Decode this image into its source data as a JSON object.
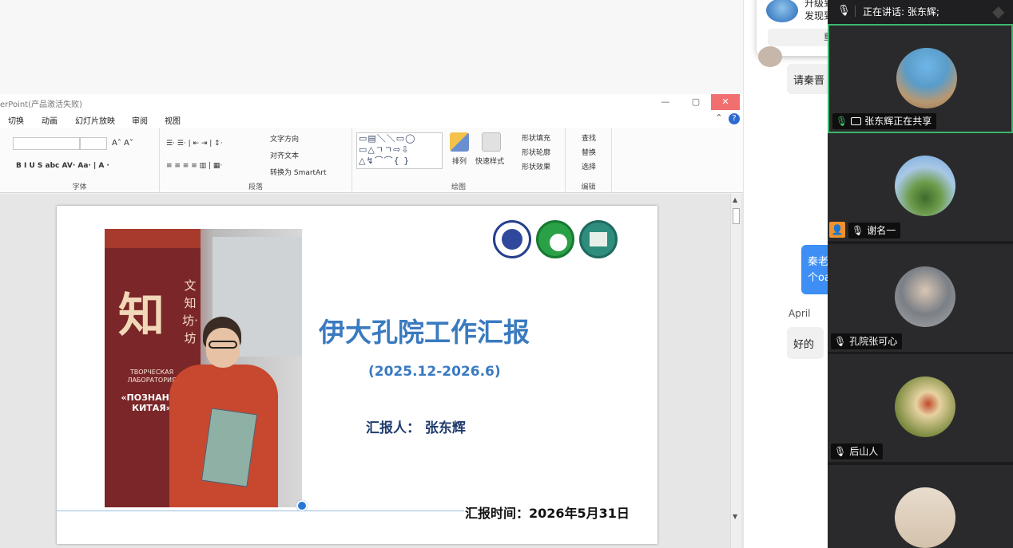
{
  "ppt": {
    "window_title": "erPoint(产品激活失败)",
    "win_min": "—",
    "win_max": "▢",
    "win_close": "✕",
    "tabs": [
      "切换",
      "动画",
      "幻灯片放映",
      "审阅",
      "视图"
    ],
    "collapse_ribbon": "⌃",
    "help": "?",
    "ribbon": {
      "font_group": "字体",
      "para_group": "段落",
      "draw_group": "绘图",
      "edit_group": "编辑",
      "font_buttons": "B  I  U  S  abc  AV·  Aa·  |  A ·",
      "grow_shrink": "A˄ A˅",
      "list_buttons": "☰·  ☰·  |  ⇤  ⇥  |  ↕·",
      "align_buttons": "≡  ≡  ≡  ≡  ▥  |  ▦·",
      "text_direction": "文字方向",
      "align_text": "对齐文本",
      "smartart": "转换为 SmartArt",
      "arrange": "排列",
      "quick_styles": "快速样式",
      "shape_fill": "形状填充",
      "shape_outline": "形状轮廓",
      "shape_effects": "形状效果",
      "find": "查找",
      "replace": "替换",
      "select": "选择",
      "shapes_row1": "▭▤＼＼▭◯",
      "shapes_row2": "▭△ㄱㄱ⇨⇩",
      "shapes_row3": "△↯⌒⌒{ }"
    }
  },
  "slide": {
    "title": "伊大孔院工作汇报",
    "subtitle": "(2025.12-2026.6)",
    "reporter": "汇报人：  张东辉",
    "date": "汇报时间：2026年5月31日",
    "photo_text_side": "文知坊·坊",
    "photo_text_ru1": "ТВОРЧЕСКАЯ ЛАБОРАТОРИЯ",
    "photo_text_ru2": "«ПОЗНАНИЕ КИТАЯ»",
    "photo_logo": "知"
  },
  "chat": {
    "notify_line1": "升级到",
    "notify_line2": "发现到",
    "notify_button": "重新",
    "msg1": "请秦晋",
    "msg2_line1": "秦老",
    "msg2_line2": "个oa",
    "sender": "April",
    "msg3": "好的"
  },
  "video": {
    "speaking_label": "正在讲话:  张东辉;",
    "tiles": [
      {
        "name": "张东辉正在共享"
      },
      {
        "name": "谢名一"
      },
      {
        "name": "孔院张可心"
      },
      {
        "name": "后山人"
      },
      {
        "name": ""
      }
    ]
  },
  "colors": {
    "title_blue": "#3a7ac0",
    "active_border": "#3fb56e",
    "chat_blue": "#3d8ff5"
  }
}
